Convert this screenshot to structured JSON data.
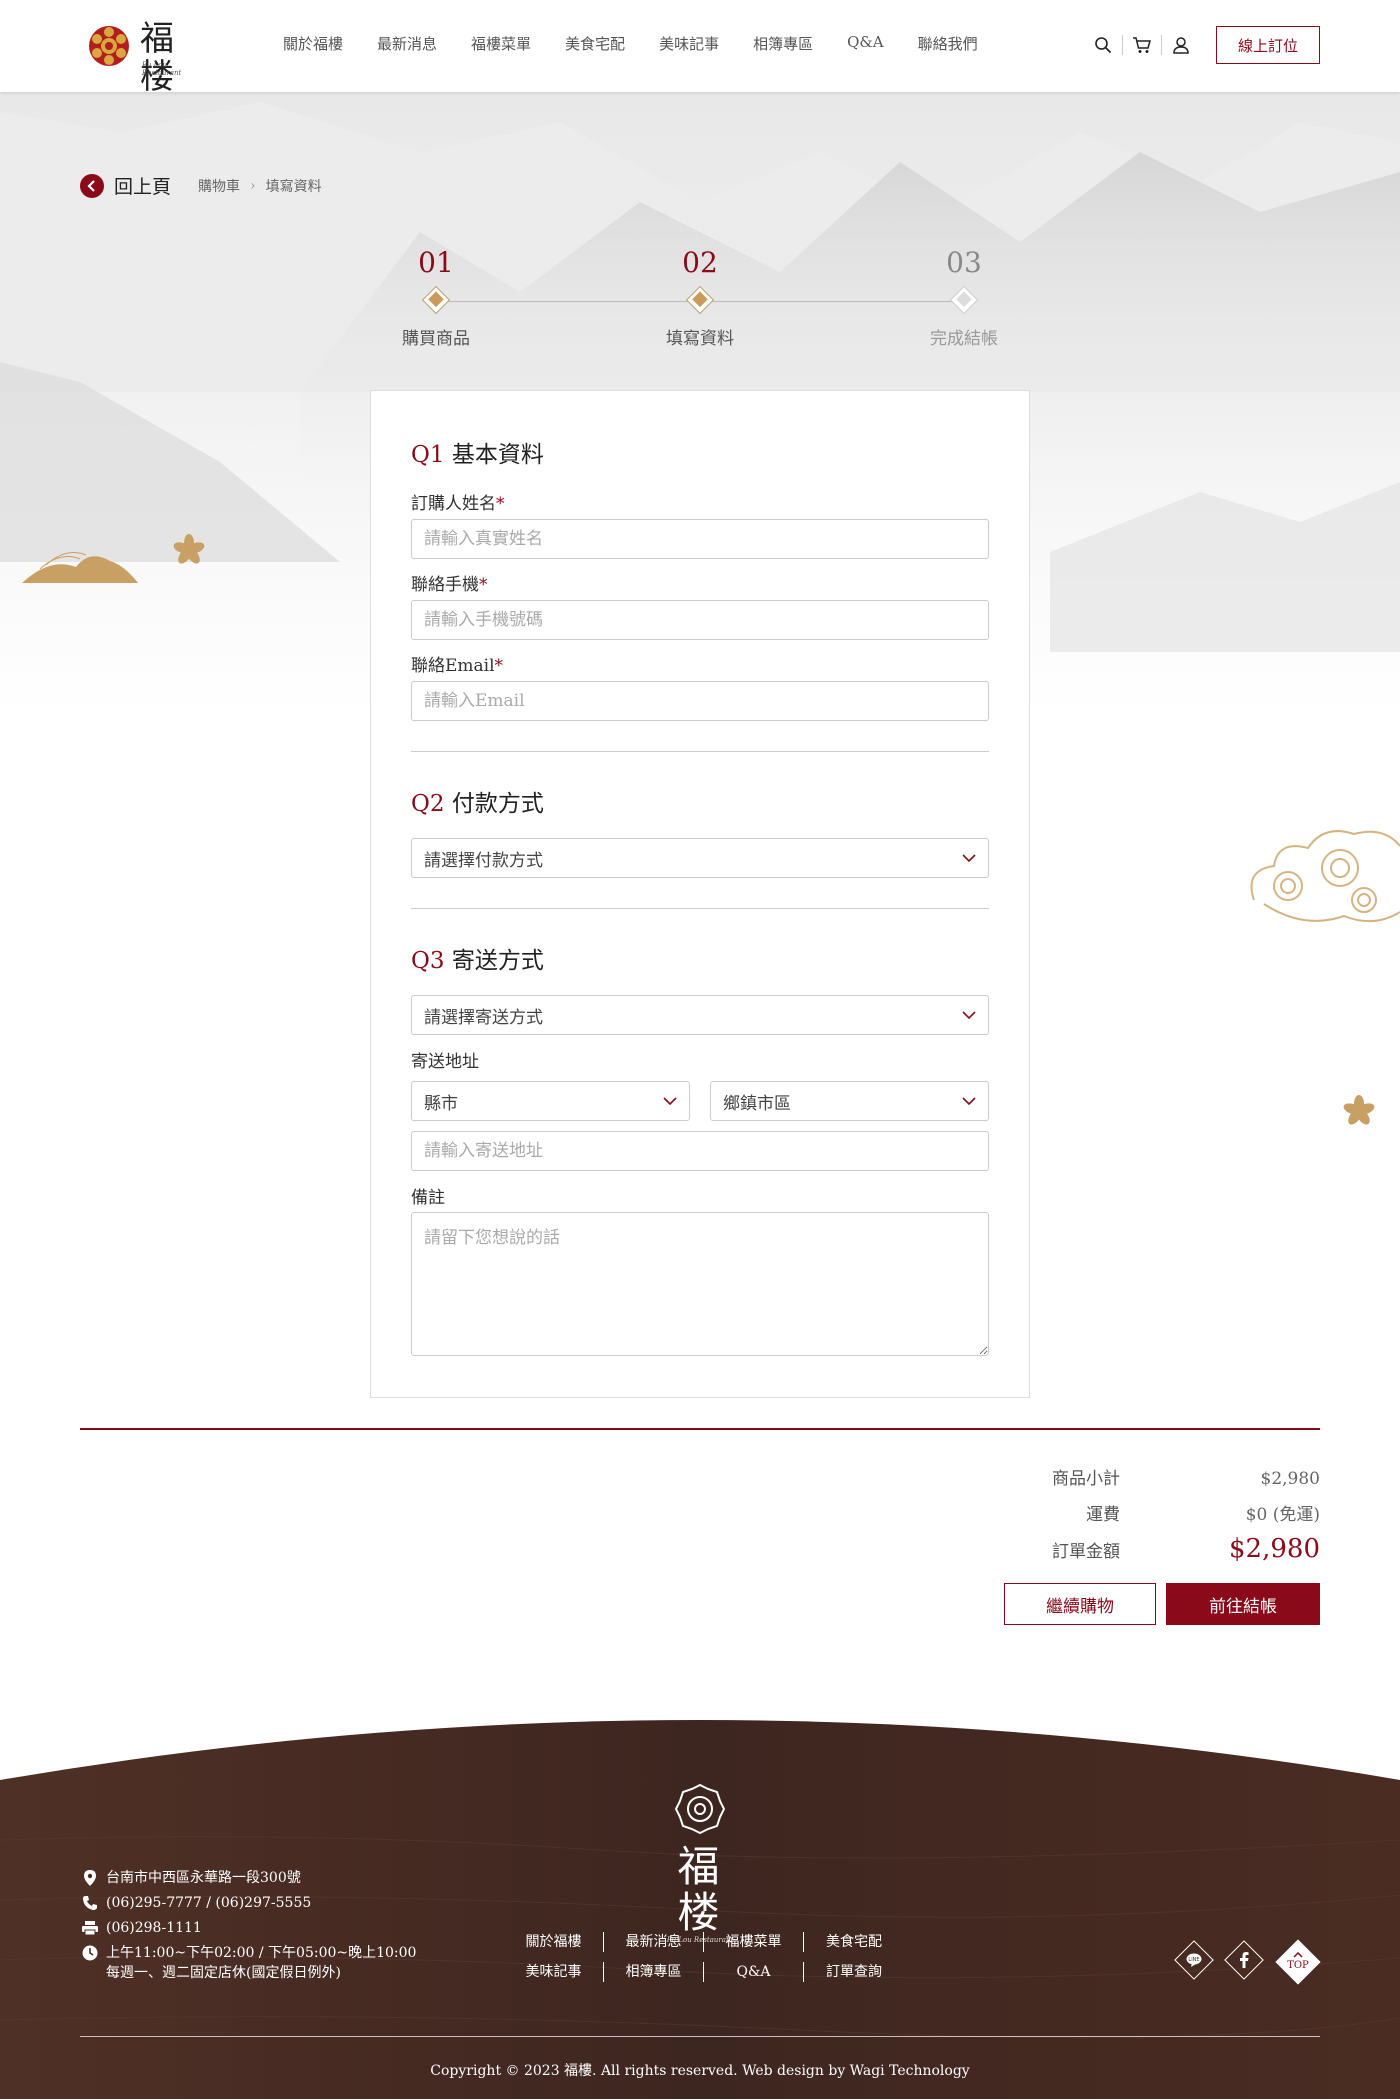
{
  "header": {
    "logo_text": "福楼",
    "logo_sub": "Fu Lou Restaurant",
    "nav": [
      "關於福樓",
      "最新消息",
      "福樓菜單",
      "美食宅配",
      "美味記事",
      "相簿專區",
      "Q&A",
      "聯絡我們"
    ],
    "icons": [
      "search-icon",
      "cart-icon",
      "user-icon"
    ],
    "order_button": "線上訂位"
  },
  "breadcrumb": {
    "back_label": "回上頁",
    "items": [
      "購物車",
      "填寫資料"
    ]
  },
  "steps": [
    {
      "num": "01",
      "label": "購買商品",
      "state": "done"
    },
    {
      "num": "02",
      "label": "填寫資料",
      "state": "active"
    },
    {
      "num": "03",
      "label": "完成結帳",
      "state": "pending"
    }
  ],
  "form": {
    "q1": {
      "prefix": "Q1",
      "title": "基本資料",
      "name_label": "訂購人姓名",
      "name_placeholder": "請輸入真實姓名",
      "phone_label": "聯絡手機",
      "phone_placeholder": "請輸入手機號碼",
      "email_label": "聯絡Email",
      "email_placeholder": "請輸入Email",
      "required_mark": "*"
    },
    "q2": {
      "prefix": "Q2",
      "title": "付款方式",
      "payment_select": "請選擇付款方式"
    },
    "q3": {
      "prefix": "Q3",
      "title": "寄送方式",
      "shipping_select": "請選擇寄送方式",
      "address_label": "寄送地址",
      "city_select": "縣市",
      "district_select": "鄉鎮市區",
      "address_placeholder": "請輸入寄送地址",
      "note_label": "備註",
      "note_placeholder": "請留下您想說的話"
    }
  },
  "summary": {
    "subtotal_label": "商品小計",
    "subtotal_value": "$2,980",
    "shipping_label": "運費",
    "shipping_value": "$0 (免運)",
    "total_label": "訂單金額",
    "total_value": "$2,980",
    "continue_button": "繼續購物",
    "checkout_button": "前往結帳"
  },
  "footer": {
    "logo_text": "福楼",
    "logo_sub": "Fu Lou Restaurant",
    "address": "台南市中西區永華路一段300號",
    "phone": "(06)295-7777 / (06)297-5555",
    "fax": "(06)298-1111",
    "hours_line1": "上午11:00~下午02:00 / 下午05:00~晚上10:00",
    "hours_line2": "每週一、週二固定店休(國定假日例外)",
    "links_row1": [
      "關於福樓",
      "最新消息",
      "福樓菜單",
      "美食宅配"
    ],
    "links_row2": [
      "美味記事",
      "相簿專區",
      "Q&A",
      "訂單查詢"
    ],
    "social": [
      "line-icon",
      "facebook-icon"
    ],
    "top_label": "TOP",
    "copyright": "Copyright © 2023 福樓. All rights reserved. Web design by Wagi Technology"
  },
  "colors": {
    "brand": "#8b0a1a",
    "gold": "#c99a5a",
    "footer_bg": "#4a2e24"
  }
}
